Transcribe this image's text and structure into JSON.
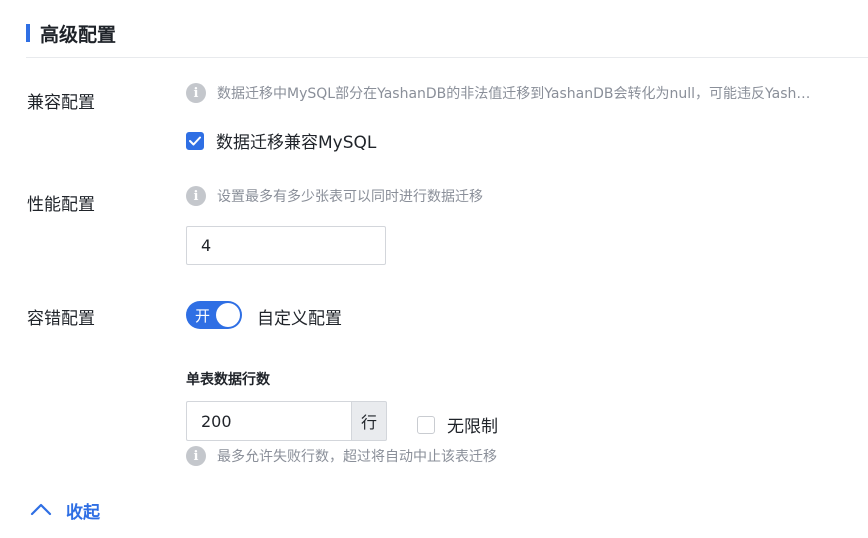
{
  "section": {
    "title": "高级配置"
  },
  "compat": {
    "label": "兼容配置",
    "hint": "数据迁移中MySQL部分在YashanDB的非法值迁移到YashanDB会转化为null，可能违反Yash…",
    "checkbox_label": "数据迁移兼容MySQL",
    "checked": true
  },
  "perf": {
    "label": "性能配置",
    "hint": "设置最多有多少张表可以同时进行数据迁移",
    "value": "4"
  },
  "fault": {
    "label": "容错配置",
    "switch_text": "开",
    "switch_on": true,
    "switch_label": "自定义配置",
    "sub_title": "单表数据行数",
    "rows_value": "200",
    "rows_unit": "行",
    "unlimited_label": "无限制",
    "unlimited_checked": false,
    "hint": "最多允许失败行数，超过将自动中止该表迁移"
  },
  "collapse": {
    "label": "收起"
  },
  "icons": {
    "info": "info-icon",
    "check": "check-icon",
    "collapse": "chevron-up-icon"
  },
  "colors": {
    "accent": "#2f6fe4",
    "hint": "#8a8f99",
    "icon_gray": "#c4c7cc"
  }
}
